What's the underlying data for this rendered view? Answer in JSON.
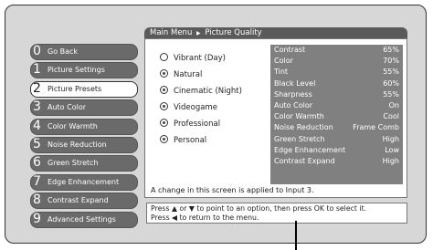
{
  "breadcrumb": {
    "root": "Main Menu",
    "separator": "▶",
    "current": "Picture Quality"
  },
  "menu": [
    {
      "num": "0",
      "label": "Go Back",
      "selected": false
    },
    {
      "num": "1",
      "label": "Picture Settings",
      "selected": false
    },
    {
      "num": "2",
      "label": "Picture Presets",
      "selected": true
    },
    {
      "num": "3",
      "label": "Auto Color",
      "selected": false
    },
    {
      "num": "4",
      "label": "Color Warmth",
      "selected": false
    },
    {
      "num": "5",
      "label": "Noise Reduction",
      "selected": false
    },
    {
      "num": "6",
      "label": "Green Stretch",
      "selected": false
    },
    {
      "num": "7",
      "label": "Edge Enhancement",
      "selected": false
    },
    {
      "num": "8",
      "label": "Contrast Expand",
      "selected": false
    },
    {
      "num": "9",
      "label": "Advanced Settings",
      "selected": false
    }
  ],
  "presets": [
    {
      "label": "Vibrant (Day)",
      "selected": false
    },
    {
      "label": "Natural",
      "selected": true
    },
    {
      "label": "Cinematic (Night)",
      "selected": true
    },
    {
      "label": "Videogame",
      "selected": true
    },
    {
      "label": "Professional",
      "selected": true
    },
    {
      "label": "Personal",
      "selected": true
    }
  ],
  "settings": [
    {
      "label": "Contrast",
      "value": "65%"
    },
    {
      "label": "Color",
      "value": "70%"
    },
    {
      "label": "Tint",
      "value": "55%"
    },
    {
      "label": "Black Level",
      "value": "60%"
    },
    {
      "label": "Sharpness",
      "value": "55%"
    },
    {
      "label": "Auto Color",
      "value": "On"
    },
    {
      "label": "Color Warmth",
      "value": "Cool"
    },
    {
      "label": "Noise Reduction",
      "value": "Frame Comb"
    },
    {
      "label": "Green Stretch",
      "value": "High"
    },
    {
      "label": "Edge Enhancement",
      "value": "Low"
    },
    {
      "label": "Contrast Expand",
      "value": "High"
    }
  ],
  "note": "A change in this screen is applied to Input 3.",
  "help": {
    "line1": "Press ▲ or ▼ to point to an option, then press OK to select it.",
    "line2": "Press ◀ to return to the menu."
  }
}
